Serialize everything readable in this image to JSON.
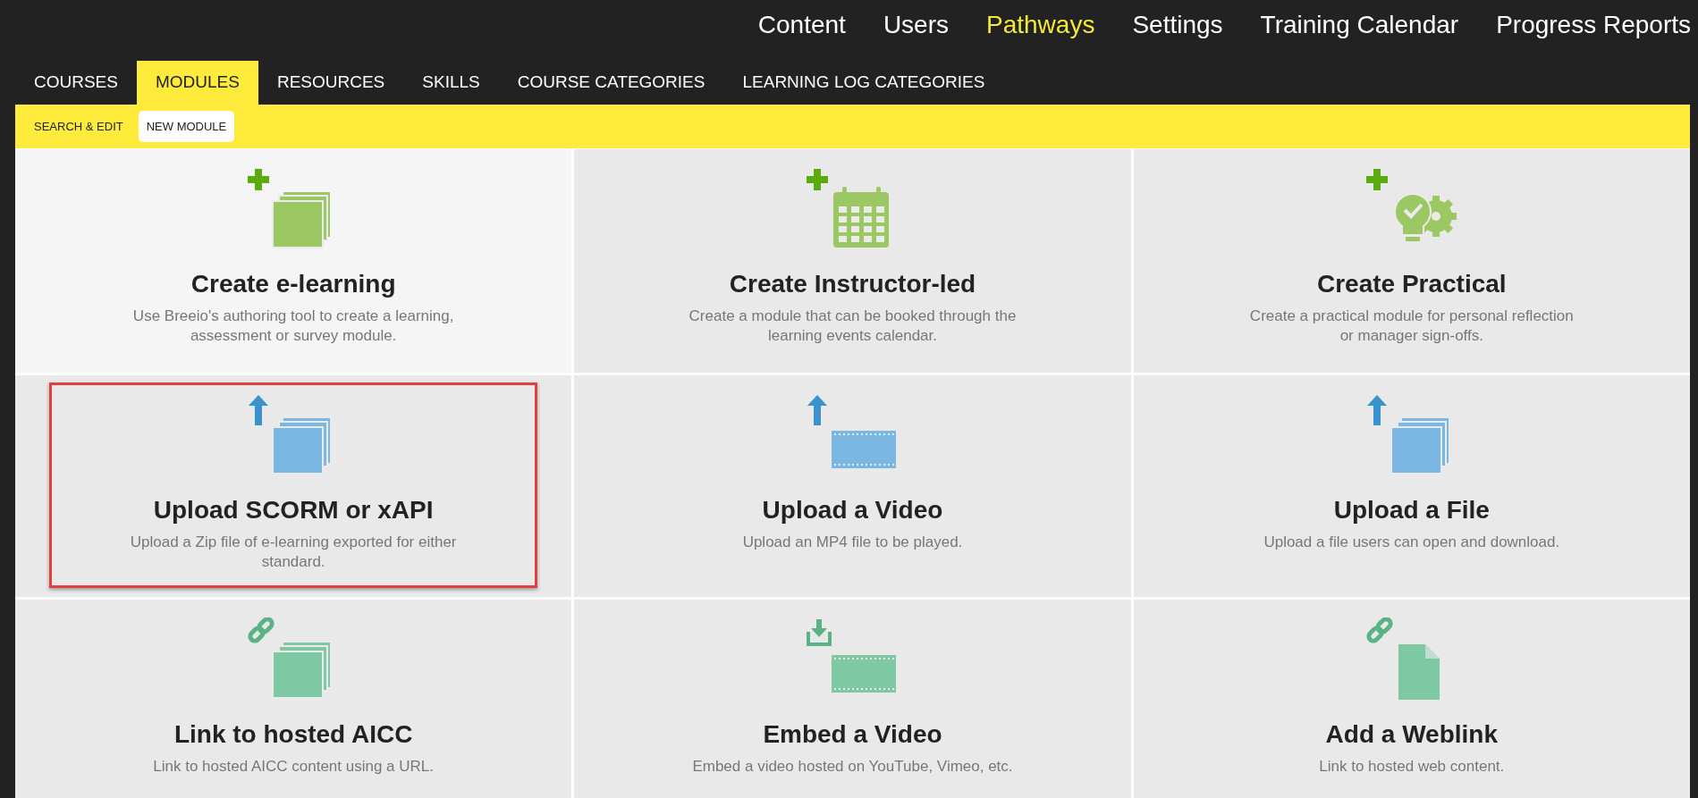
{
  "top_nav": [
    {
      "label": "Content",
      "selected": false
    },
    {
      "label": "Users",
      "selected": false
    },
    {
      "label": "Pathways",
      "selected": true
    },
    {
      "label": "Settings",
      "selected": false
    },
    {
      "label": "Training Calendar",
      "selected": false
    },
    {
      "label": "Progress Reports",
      "selected": false
    }
  ],
  "tabs": [
    {
      "label": "COURSES",
      "selected": false
    },
    {
      "label": "MODULES",
      "selected": true
    },
    {
      "label": "RESOURCES",
      "selected": false
    },
    {
      "label": "SKILLS",
      "selected": false
    },
    {
      "label": "COURSE CATEGORIES",
      "selected": false
    },
    {
      "label": "LEARNING LOG CATEGORIES",
      "selected": false
    }
  ],
  "subtabs": [
    {
      "label": "SEARCH & EDIT",
      "selected": false
    },
    {
      "label": "NEW MODULE",
      "selected": true
    }
  ],
  "cards": [
    {
      "title": "Create e-learning",
      "description": "Use Breeio's authoring tool to create a learning, assessment or survey module.",
      "kind": "elearning",
      "hovered": true,
      "outlined": false
    },
    {
      "title": "Create Instructor-led",
      "description": "Create a module that can be booked through the learning events calendar.",
      "kind": "instructor",
      "hovered": false,
      "outlined": false
    },
    {
      "title": "Create Practical",
      "description": "Create a practical module for personal reflection or manager sign-offs.",
      "kind": "practical",
      "hovered": false,
      "outlined": false
    },
    {
      "title": "Upload SCORM or xAPI",
      "description": "Upload a Zip file of e-learning exported for either standard.",
      "kind": "scorm",
      "hovered": false,
      "outlined": true
    },
    {
      "title": "Upload a Video",
      "description": "Upload an MP4 file to be played.",
      "kind": "video",
      "hovered": false,
      "outlined": false
    },
    {
      "title": "Upload a File",
      "description": "Upload a file users can open and download.",
      "kind": "file",
      "hovered": false,
      "outlined": false
    },
    {
      "title": "Link to hosted AICC",
      "description": "Link to hosted AICC content using a URL.",
      "kind": "aicc",
      "hovered": false,
      "outlined": false
    },
    {
      "title": "Embed a Video",
      "description": "Embed a video hosted on YouTube, Vimeo, etc.",
      "kind": "embed",
      "hovered": false,
      "outlined": false
    },
    {
      "title": "Add a Weblink",
      "description": "Link to hosted web content.",
      "kind": "weblink",
      "hovered": false,
      "outlined": false
    }
  ]
}
